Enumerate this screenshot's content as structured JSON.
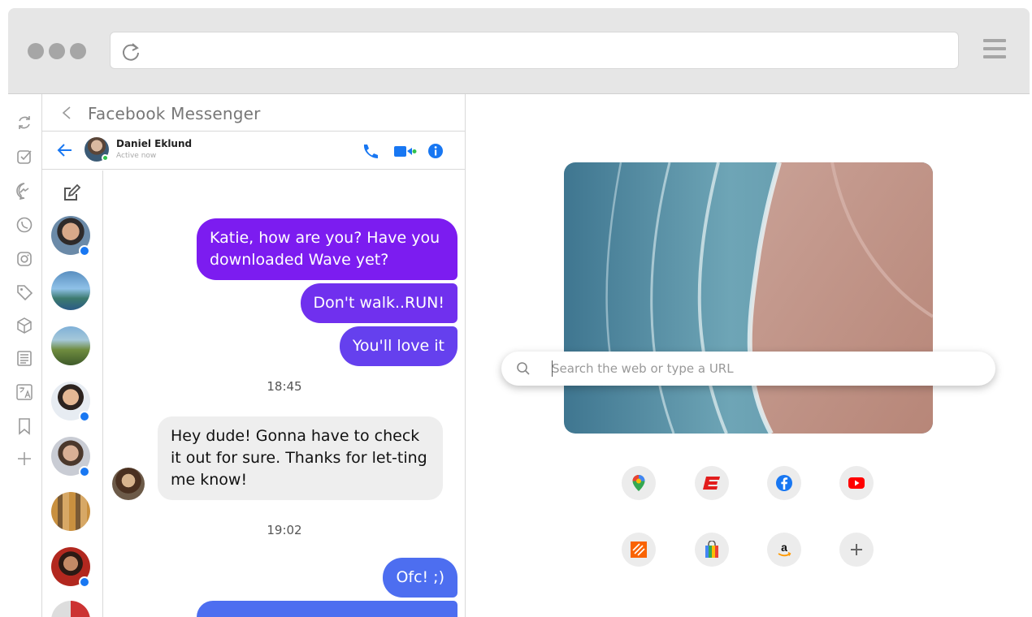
{
  "browser": {
    "address_value": "",
    "window_controls": [
      "dot",
      "dot",
      "dot"
    ]
  },
  "rail": {
    "icons": [
      "sync-icon",
      "checkbox-icon",
      "messenger-icon",
      "whatsapp-icon",
      "instagram-icon",
      "tag-icon",
      "cube-icon",
      "news-icon",
      "translate-icon",
      "bookmark-icon",
      "plus-icon"
    ]
  },
  "messenger": {
    "title": "Facebook Messenger",
    "contact_name": "Daniel Eklund",
    "contact_status": "Active now",
    "accent": "#1877f2"
  },
  "messages": [
    {
      "dir": "out",
      "text": "Katie, how are you? Have you downloaded Wave yet?"
    },
    {
      "dir": "out",
      "text": "Don't walk..RUN!"
    },
    {
      "dir": "out",
      "text": "You'll love it"
    },
    {
      "dir": "time",
      "text": "18:45"
    },
    {
      "dir": "in",
      "text": "Hey dude! Gonna have to check it out for sure. Thanks for let-ting me know!"
    },
    {
      "dir": "time",
      "text": "19:02"
    },
    {
      "dir": "out",
      "text": "Ofc! ;)"
    }
  ],
  "newtab": {
    "search_placeholder": "Search the web or type a URL",
    "shortcuts": [
      "google-maps-icon",
      "espn-icon",
      "facebook-icon",
      "youtube-icon",
      "home-depot-icon",
      "shopping-bag-icon",
      "amazon-icon",
      "add-shortcut-icon"
    ]
  },
  "colors": {
    "bubble_purple": "#7c1cf0",
    "bubble_violet": "#6c38ee",
    "bubble_blue": "#4d6ef0",
    "incoming_bg": "#eeeeee"
  }
}
